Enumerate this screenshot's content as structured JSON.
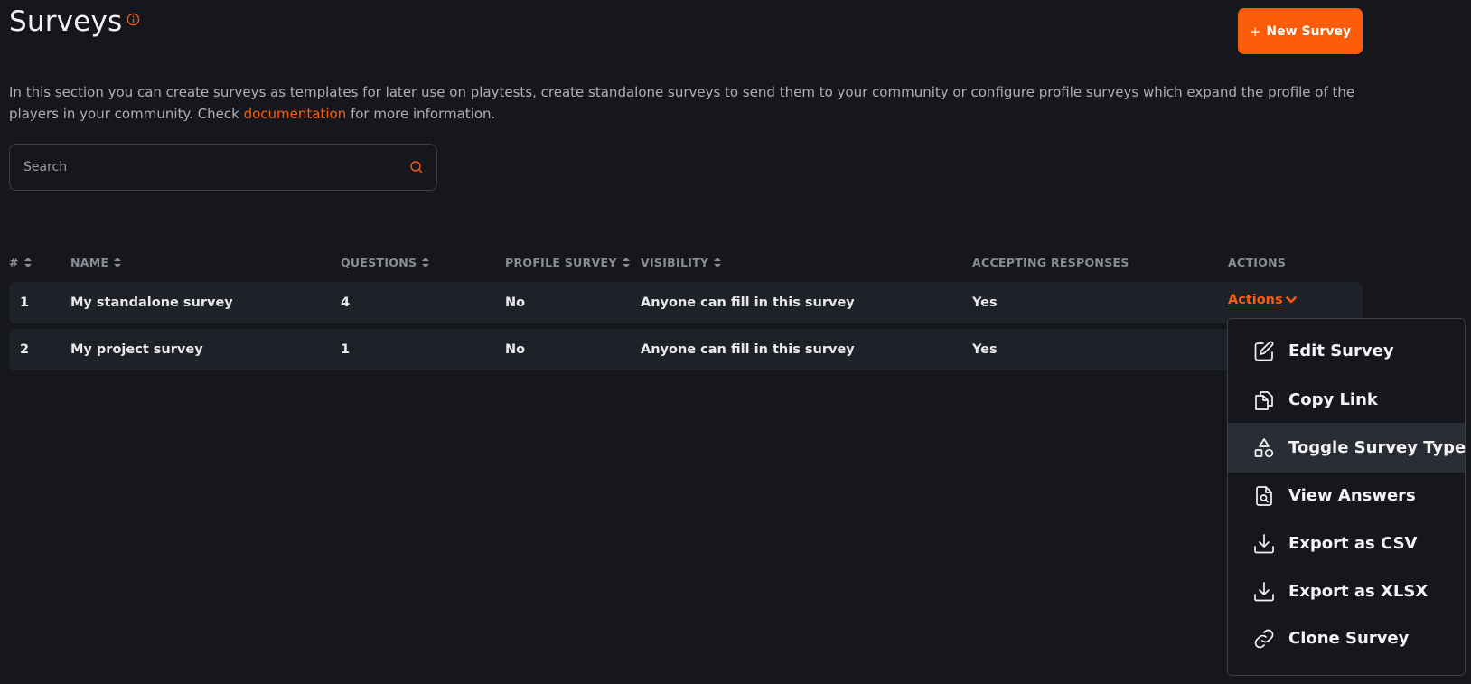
{
  "header": {
    "title": "Surveys",
    "new_button_plus": "+",
    "new_button_label": "New Survey"
  },
  "description": {
    "before_link": "In this section you can create surveys as templates for later use on playtests, create standalone surveys to send them to your community or configure profile surveys which expand the profile of the players in your community. Check ",
    "link": "documentation",
    "after_link": " for more information."
  },
  "search": {
    "placeholder": "Search"
  },
  "table": {
    "columns": [
      "#",
      "NAME",
      "QUESTIONS",
      "PROFILE SURVEY",
      "VISIBILITY",
      "ACCEPTING RESPONSES",
      "ACTIONS"
    ],
    "rows": [
      [
        "1",
        "My standalone survey",
        "4",
        "No",
        "Anyone can fill in this survey",
        "Yes"
      ],
      [
        "2",
        "My project survey",
        "1",
        "No",
        "Anyone can fill in this survey",
        "Yes"
      ]
    ],
    "actions_label": "Actions"
  },
  "menu": {
    "items": [
      {
        "label": "Edit Survey",
        "icon": "edit-icon"
      },
      {
        "label": "Copy Link",
        "icon": "copy-icon"
      },
      {
        "label": "Toggle Survey Type",
        "icon": "shapes-icon",
        "highlighted": true
      },
      {
        "label": "View Answers",
        "icon": "file-search-icon"
      },
      {
        "label": "Export as CSV",
        "icon": "download-icon"
      },
      {
        "label": "Export as XLSX",
        "icon": "download-icon"
      },
      {
        "label": "Clone Survey",
        "icon": "link-icon"
      }
    ]
  },
  "colors": {
    "accent": "#fa5c0a",
    "background": "#15171c",
    "row": "#1f2128"
  }
}
